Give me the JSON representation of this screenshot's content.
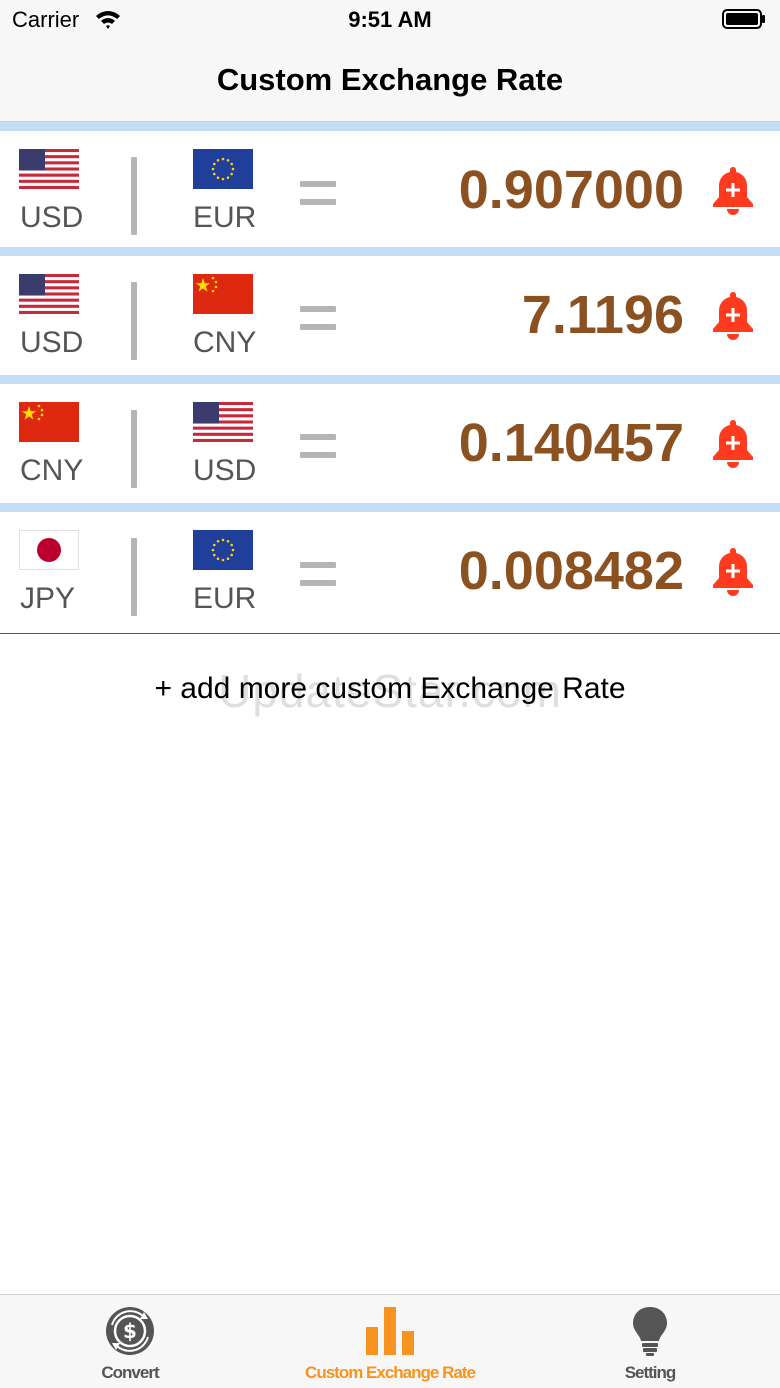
{
  "status_bar": {
    "carrier": "Carrier",
    "time": "9:51 AM"
  },
  "nav": {
    "title": "Custom Exchange Rate"
  },
  "rates": [
    {
      "from_code": "USD",
      "to_code": "EUR",
      "from_flag": "us-flag-icon",
      "to_flag": "eu-flag-icon",
      "value": "0.907000"
    },
    {
      "from_code": "USD",
      "to_code": "CNY",
      "from_flag": "us-flag-icon",
      "to_flag": "cn-flag-icon",
      "value": "7.1196"
    },
    {
      "from_code": "CNY",
      "to_code": "USD",
      "from_flag": "cn-flag-icon",
      "to_flag": "us-flag-icon",
      "value": "0.140457"
    },
    {
      "from_code": "JPY",
      "to_code": "EUR",
      "from_flag": "jp-flag-icon",
      "to_flag": "eu-flag-icon",
      "value": "0.008482"
    }
  ],
  "add_more": "+ add more custom Exchange Rate",
  "watermark": "UpdateStar.com",
  "tabs": [
    {
      "label": "Convert",
      "icon": "currency-convert-icon",
      "active": false
    },
    {
      "label": "Custom Exchange Rate",
      "icon": "bar-chart-icon",
      "active": true
    },
    {
      "label": "Setting",
      "icon": "lightbulb-icon",
      "active": false
    }
  ],
  "colors": {
    "rate_value": "#8b5121",
    "bell": "#ff3b1f",
    "active_tab": "#f7931e",
    "inactive_tab": "#555555",
    "row_separator": "#c4def6"
  }
}
